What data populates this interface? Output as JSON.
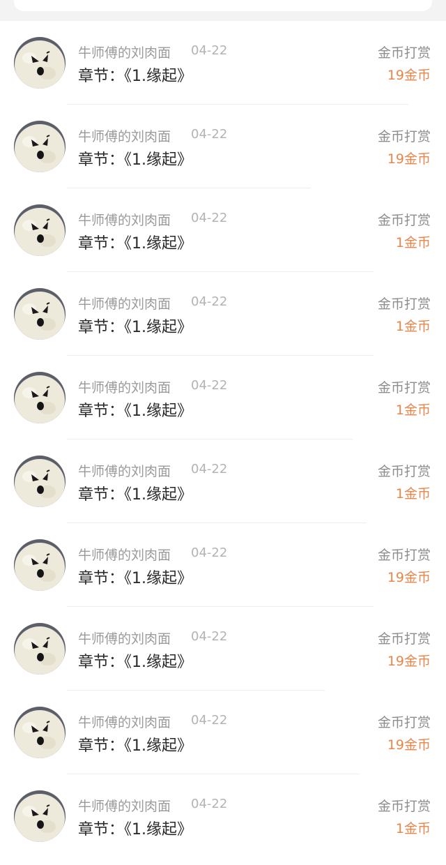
{
  "records": [
    {
      "user": "牛师傅的刘肉面",
      "date": "04-22",
      "chapter": "章节：《1.缘起》",
      "tip_type": "金币打赏",
      "amount": "19金币",
      "avatar_icon": "angry-white-bear-avatar"
    },
    {
      "user": "牛师傅的刘肉面",
      "date": "04-22",
      "chapter": "章节：《1.缘起》",
      "tip_type": "金币打赏",
      "amount": "19金币",
      "avatar_icon": "angry-white-bear-avatar"
    },
    {
      "user": "牛师傅的刘肉面",
      "date": "04-22",
      "chapter": "章节：《1.缘起》",
      "tip_type": "金币打赏",
      "amount": "1金币",
      "avatar_icon": "angry-white-bear-avatar"
    },
    {
      "user": "牛师傅的刘肉面",
      "date": "04-22",
      "chapter": "章节：《1.缘起》",
      "tip_type": "金币打赏",
      "amount": "1金币",
      "avatar_icon": "angry-white-bear-avatar"
    },
    {
      "user": "牛师傅的刘肉面",
      "date": "04-22",
      "chapter": "章节：《1.缘起》",
      "tip_type": "金币打赏",
      "amount": "1金币",
      "avatar_icon": "angry-white-bear-avatar"
    },
    {
      "user": "牛师傅的刘肉面",
      "date": "04-22",
      "chapter": "章节：《1.缘起》",
      "tip_type": "金币打赏",
      "amount": "1金币",
      "avatar_icon": "angry-white-bear-avatar"
    },
    {
      "user": "牛师傅的刘肉面",
      "date": "04-22",
      "chapter": "章节：《1.缘起》",
      "tip_type": "金币打赏",
      "amount": "19金币",
      "avatar_icon": "angry-white-bear-avatar"
    },
    {
      "user": "牛师傅的刘肉面",
      "date": "04-22",
      "chapter": "章节：《1.缘起》",
      "tip_type": "金币打赏",
      "amount": "19金币",
      "avatar_icon": "angry-white-bear-avatar"
    },
    {
      "user": "牛师傅的刘肉面",
      "date": "04-22",
      "chapter": "章节：《1.缘起》",
      "tip_type": "金币打赏",
      "amount": "19金币",
      "avatar_icon": "angry-white-bear-avatar"
    },
    {
      "user": "牛师傅的刘肉面",
      "date": "04-22",
      "chapter": "章节：《1.缘起》",
      "tip_type": "金币打赏",
      "amount": "1金币",
      "avatar_icon": "angry-white-bear-avatar"
    }
  ],
  "colors": {
    "amount": "#e8864a",
    "name": "#9a9a9a",
    "chapter": "#2a2a2a"
  }
}
